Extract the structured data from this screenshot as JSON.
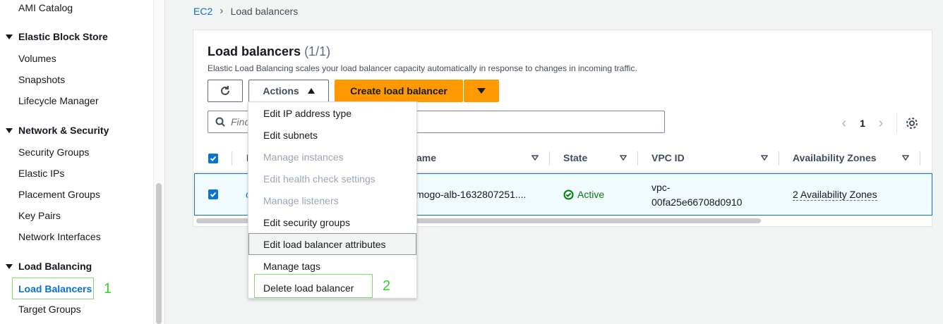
{
  "sidebar": {
    "top_item": "AMI Catalog",
    "groups": [
      {
        "label": "Elastic Block Store",
        "items": [
          "Volumes",
          "Snapshots",
          "Lifecycle Manager"
        ]
      },
      {
        "label": "Network & Security",
        "items": [
          "Security Groups",
          "Elastic IPs",
          "Placement Groups",
          "Key Pairs",
          "Network Interfaces"
        ]
      },
      {
        "label": "Load Balancing",
        "items": [
          "Load Balancers",
          "Target Groups"
        ]
      }
    ],
    "active_item": "Load Balancers"
  },
  "annotations": {
    "step1": "1",
    "step2": "2"
  },
  "breadcrumb": {
    "root": "EC2",
    "current": "Load balancers"
  },
  "panel": {
    "title": "Load balancers",
    "count": "(1/1)",
    "description": "Elastic Load Balancing scales your load balancer capacity automatically in response to changes in incoming traffic.",
    "actions_label": "Actions",
    "create_label": "Create load balancer",
    "search_placeholder": "Find",
    "page_number": "1"
  },
  "table": {
    "columns": [
      "N",
      "ame",
      "State",
      "VPC ID",
      "Availability Zones"
    ],
    "rows": [
      {
        "name_fragment": "c",
        "dns_name": "mogo-alb-1632807251....",
        "state": "Active",
        "vpc_line1": "vpc-",
        "vpc_line2": "00fa25e66708d0910",
        "az": "2 Availability Zones",
        "selected": true
      }
    ]
  },
  "actions_menu": {
    "items": [
      {
        "label": "Edit IP address type",
        "enabled": true
      },
      {
        "label": "Edit subnets",
        "enabled": true
      },
      {
        "label": "Manage instances",
        "enabled": false
      },
      {
        "label": "Edit health check settings",
        "enabled": false
      },
      {
        "label": "Manage listeners",
        "enabled": false
      },
      {
        "label": "Edit security groups",
        "enabled": true
      },
      {
        "label": "Edit load balancer attributes",
        "enabled": true
      },
      {
        "label": "Manage tags",
        "enabled": true
      },
      {
        "label": "Delete load balancer",
        "enabled": true
      }
    ]
  },
  "colors": {
    "accent": "#0972d3",
    "primary_button": "#ff9900",
    "success": "#037f0c",
    "annotation": "#36d12b"
  }
}
